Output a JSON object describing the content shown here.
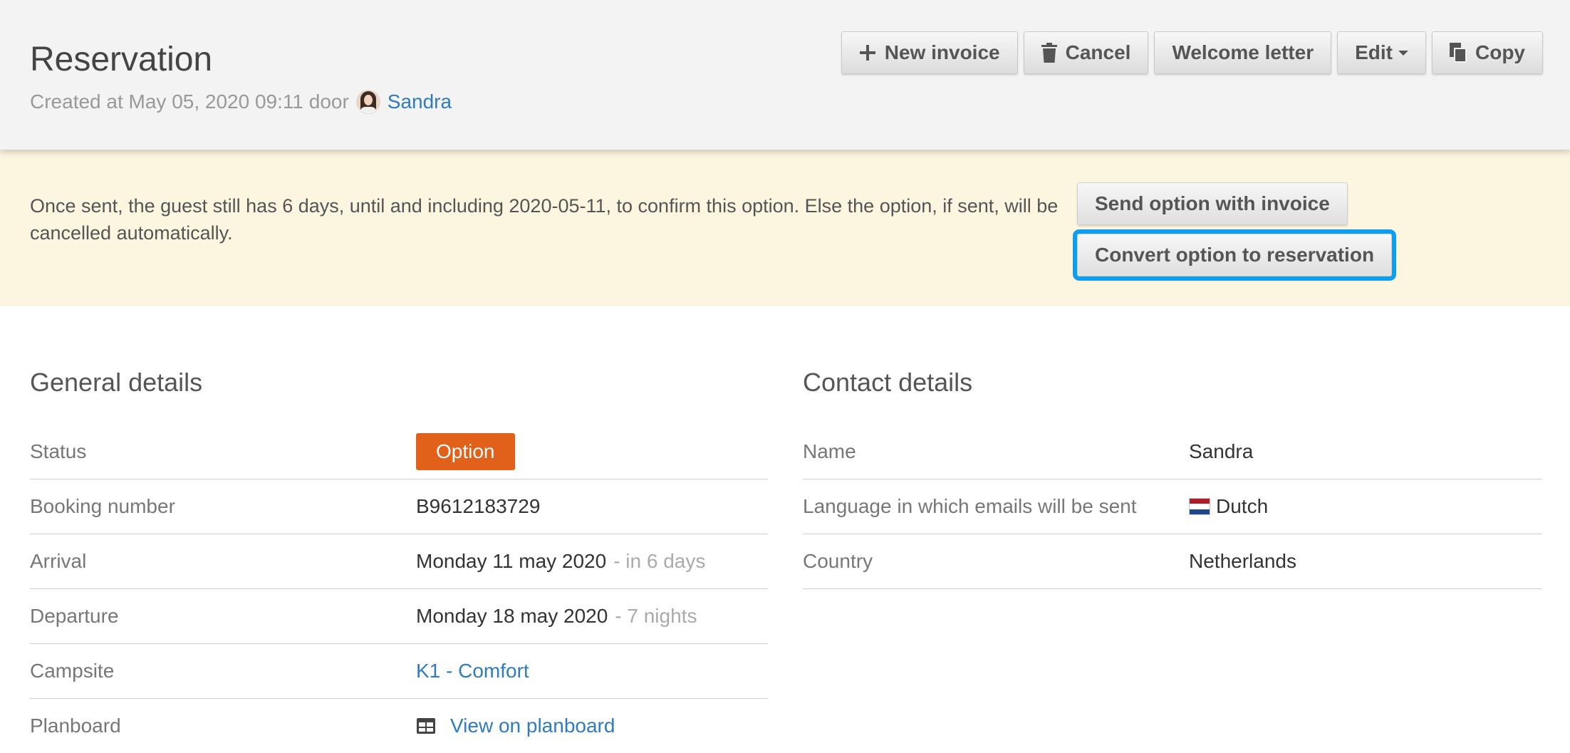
{
  "header": {
    "title": "Reservation",
    "created_prefix": "Created at May 05, 2020 09:11 door",
    "created_by": "Sandra",
    "avatar_icon": "user-avatar",
    "toolbar": {
      "new_invoice": "New invoice",
      "cancel": "Cancel",
      "welcome_letter": "Welcome letter",
      "edit": "Edit",
      "copy": "Copy"
    }
  },
  "banner": {
    "message": "Once sent, the guest still has 6 days, until and including 2020-05-11, to confirm this option. Else the option, if sent, will be cancelled automatically.",
    "send_button": "Send option with invoice",
    "convert_button": "Convert option to reservation"
  },
  "general": {
    "title": "General details",
    "rows": [
      {
        "label": "Status",
        "value": "Option"
      },
      {
        "label": "Booking number",
        "value": "B9612183729"
      },
      {
        "label": "Arrival",
        "value": "Monday 11 may 2020",
        "extra": "- in 6 days"
      },
      {
        "label": "Departure",
        "value": "Monday 18 may 2020",
        "extra": "- 7 nights"
      },
      {
        "label": "Campsite",
        "value": "K1 - Comfort"
      },
      {
        "label": "Planboard",
        "value": "View on planboard"
      }
    ]
  },
  "contact": {
    "title": "Contact details",
    "rows": [
      {
        "label": "Name",
        "value": "Sandra"
      },
      {
        "label": "Language in which emails will be sent",
        "value": "Dutch"
      },
      {
        "label": "Country",
        "value": "Netherlands"
      }
    ]
  },
  "colors": {
    "status_badge": "#e1601a",
    "link": "#2f7bc2",
    "banner_bg": "#fcf5df",
    "focus_outline": "#0d9ef0"
  }
}
